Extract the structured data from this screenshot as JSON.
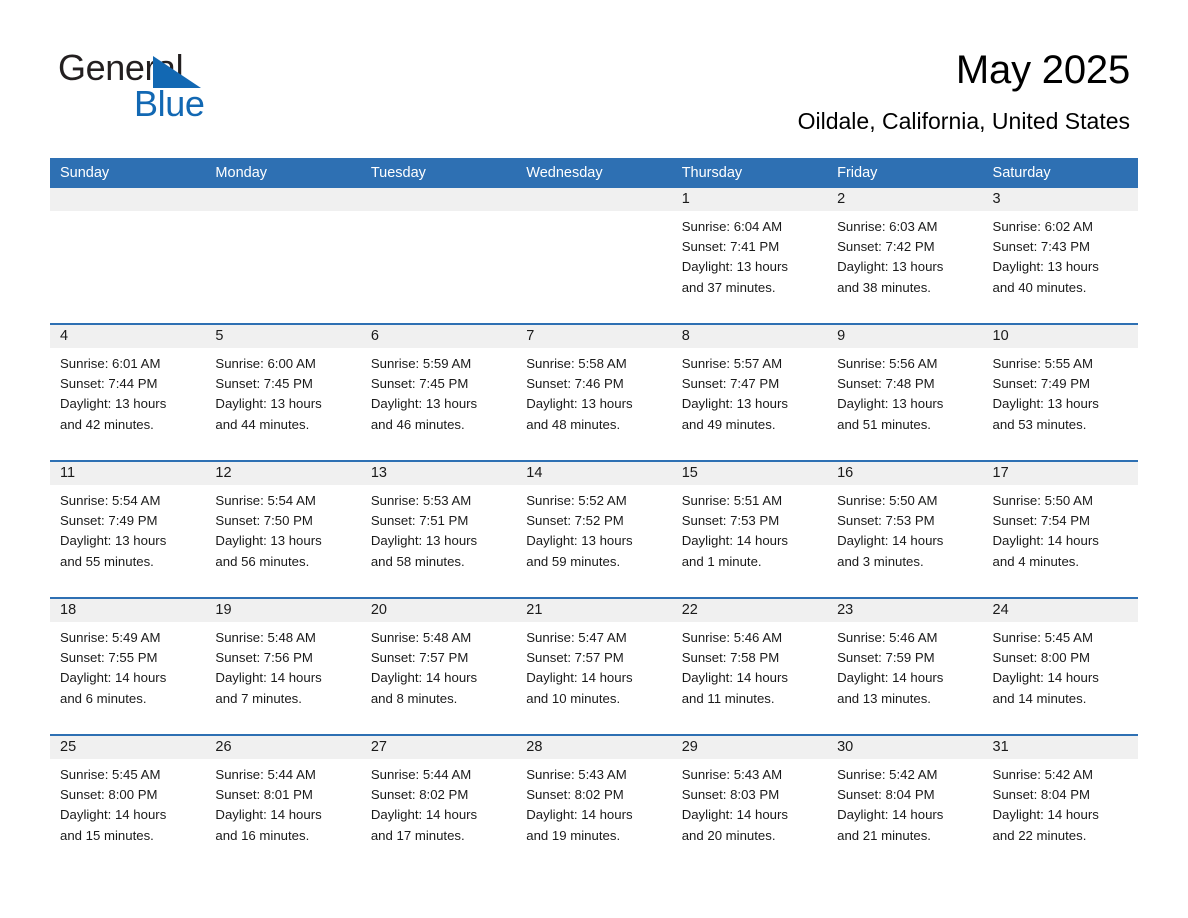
{
  "brand": {
    "name_part1": "General",
    "name_part2": "Blue",
    "triangle_color": "#1268b3",
    "text_color": "#231f20"
  },
  "header": {
    "month_title": "May 2025",
    "location": "Oildale, California, United States"
  },
  "colors": {
    "header_blue": "#2e70b3",
    "date_strip_gray": "#f0f0f0",
    "text": "#1a1a1a"
  },
  "calendar": {
    "weekday_headers": [
      "Sunday",
      "Monday",
      "Tuesday",
      "Wednesday",
      "Thursday",
      "Friday",
      "Saturday"
    ],
    "weeks": [
      {
        "days": [
          {
            "number": "",
            "sunrise": "",
            "sunset": "",
            "daylight1": "",
            "daylight2": ""
          },
          {
            "number": "",
            "sunrise": "",
            "sunset": "",
            "daylight1": "",
            "daylight2": ""
          },
          {
            "number": "",
            "sunrise": "",
            "sunset": "",
            "daylight1": "",
            "daylight2": ""
          },
          {
            "number": "",
            "sunrise": "",
            "sunset": "",
            "daylight1": "",
            "daylight2": ""
          },
          {
            "number": "1",
            "sunrise": "Sunrise: 6:04 AM",
            "sunset": "Sunset: 7:41 PM",
            "daylight1": "Daylight: 13 hours",
            "daylight2": "and 37 minutes."
          },
          {
            "number": "2",
            "sunrise": "Sunrise: 6:03 AM",
            "sunset": "Sunset: 7:42 PM",
            "daylight1": "Daylight: 13 hours",
            "daylight2": "and 38 minutes."
          },
          {
            "number": "3",
            "sunrise": "Sunrise: 6:02 AM",
            "sunset": "Sunset: 7:43 PM",
            "daylight1": "Daylight: 13 hours",
            "daylight2": "and 40 minutes."
          }
        ]
      },
      {
        "days": [
          {
            "number": "4",
            "sunrise": "Sunrise: 6:01 AM",
            "sunset": "Sunset: 7:44 PM",
            "daylight1": "Daylight: 13 hours",
            "daylight2": "and 42 minutes."
          },
          {
            "number": "5",
            "sunrise": "Sunrise: 6:00 AM",
            "sunset": "Sunset: 7:45 PM",
            "daylight1": "Daylight: 13 hours",
            "daylight2": "and 44 minutes."
          },
          {
            "number": "6",
            "sunrise": "Sunrise: 5:59 AM",
            "sunset": "Sunset: 7:45 PM",
            "daylight1": "Daylight: 13 hours",
            "daylight2": "and 46 minutes."
          },
          {
            "number": "7",
            "sunrise": "Sunrise: 5:58 AM",
            "sunset": "Sunset: 7:46 PM",
            "daylight1": "Daylight: 13 hours",
            "daylight2": "and 48 minutes."
          },
          {
            "number": "8",
            "sunrise": "Sunrise: 5:57 AM",
            "sunset": "Sunset: 7:47 PM",
            "daylight1": "Daylight: 13 hours",
            "daylight2": "and 49 minutes."
          },
          {
            "number": "9",
            "sunrise": "Sunrise: 5:56 AM",
            "sunset": "Sunset: 7:48 PM",
            "daylight1": "Daylight: 13 hours",
            "daylight2": "and 51 minutes."
          },
          {
            "number": "10",
            "sunrise": "Sunrise: 5:55 AM",
            "sunset": "Sunset: 7:49 PM",
            "daylight1": "Daylight: 13 hours",
            "daylight2": "and 53 minutes."
          }
        ]
      },
      {
        "days": [
          {
            "number": "11",
            "sunrise": "Sunrise: 5:54 AM",
            "sunset": "Sunset: 7:49 PM",
            "daylight1": "Daylight: 13 hours",
            "daylight2": "and 55 minutes."
          },
          {
            "number": "12",
            "sunrise": "Sunrise: 5:54 AM",
            "sunset": "Sunset: 7:50 PM",
            "daylight1": "Daylight: 13 hours",
            "daylight2": "and 56 minutes."
          },
          {
            "number": "13",
            "sunrise": "Sunrise: 5:53 AM",
            "sunset": "Sunset: 7:51 PM",
            "daylight1": "Daylight: 13 hours",
            "daylight2": "and 58 minutes."
          },
          {
            "number": "14",
            "sunrise": "Sunrise: 5:52 AM",
            "sunset": "Sunset: 7:52 PM",
            "daylight1": "Daylight: 13 hours",
            "daylight2": "and 59 minutes."
          },
          {
            "number": "15",
            "sunrise": "Sunrise: 5:51 AM",
            "sunset": "Sunset: 7:53 PM",
            "daylight1": "Daylight: 14 hours",
            "daylight2": "and 1 minute."
          },
          {
            "number": "16",
            "sunrise": "Sunrise: 5:50 AM",
            "sunset": "Sunset: 7:53 PM",
            "daylight1": "Daylight: 14 hours",
            "daylight2": "and 3 minutes."
          },
          {
            "number": "17",
            "sunrise": "Sunrise: 5:50 AM",
            "sunset": "Sunset: 7:54 PM",
            "daylight1": "Daylight: 14 hours",
            "daylight2": "and 4 minutes."
          }
        ]
      },
      {
        "days": [
          {
            "number": "18",
            "sunrise": "Sunrise: 5:49 AM",
            "sunset": "Sunset: 7:55 PM",
            "daylight1": "Daylight: 14 hours",
            "daylight2": "and 6 minutes."
          },
          {
            "number": "19",
            "sunrise": "Sunrise: 5:48 AM",
            "sunset": "Sunset: 7:56 PM",
            "daylight1": "Daylight: 14 hours",
            "daylight2": "and 7 minutes."
          },
          {
            "number": "20",
            "sunrise": "Sunrise: 5:48 AM",
            "sunset": "Sunset: 7:57 PM",
            "daylight1": "Daylight: 14 hours",
            "daylight2": "and 8 minutes."
          },
          {
            "number": "21",
            "sunrise": "Sunrise: 5:47 AM",
            "sunset": "Sunset: 7:57 PM",
            "daylight1": "Daylight: 14 hours",
            "daylight2": "and 10 minutes."
          },
          {
            "number": "22",
            "sunrise": "Sunrise: 5:46 AM",
            "sunset": "Sunset: 7:58 PM",
            "daylight1": "Daylight: 14 hours",
            "daylight2": "and 11 minutes."
          },
          {
            "number": "23",
            "sunrise": "Sunrise: 5:46 AM",
            "sunset": "Sunset: 7:59 PM",
            "daylight1": "Daylight: 14 hours",
            "daylight2": "and 13 minutes."
          },
          {
            "number": "24",
            "sunrise": "Sunrise: 5:45 AM",
            "sunset": "Sunset: 8:00 PM",
            "daylight1": "Daylight: 14 hours",
            "daylight2": "and 14 minutes."
          }
        ]
      },
      {
        "days": [
          {
            "number": "25",
            "sunrise": "Sunrise: 5:45 AM",
            "sunset": "Sunset: 8:00 PM",
            "daylight1": "Daylight: 14 hours",
            "daylight2": "and 15 minutes."
          },
          {
            "number": "26",
            "sunrise": "Sunrise: 5:44 AM",
            "sunset": "Sunset: 8:01 PM",
            "daylight1": "Daylight: 14 hours",
            "daylight2": "and 16 minutes."
          },
          {
            "number": "27",
            "sunrise": "Sunrise: 5:44 AM",
            "sunset": "Sunset: 8:02 PM",
            "daylight1": "Daylight: 14 hours",
            "daylight2": "and 17 minutes."
          },
          {
            "number": "28",
            "sunrise": "Sunrise: 5:43 AM",
            "sunset": "Sunset: 8:02 PM",
            "daylight1": "Daylight: 14 hours",
            "daylight2": "and 19 minutes."
          },
          {
            "number": "29",
            "sunrise": "Sunrise: 5:43 AM",
            "sunset": "Sunset: 8:03 PM",
            "daylight1": "Daylight: 14 hours",
            "daylight2": "and 20 minutes."
          },
          {
            "number": "30",
            "sunrise": "Sunrise: 5:42 AM",
            "sunset": "Sunset: 8:04 PM",
            "daylight1": "Daylight: 14 hours",
            "daylight2": "and 21 minutes."
          },
          {
            "number": "31",
            "sunrise": "Sunrise: 5:42 AM",
            "sunset": "Sunset: 8:04 PM",
            "daylight1": "Daylight: 14 hours",
            "daylight2": "and 22 minutes."
          }
        ]
      }
    ]
  }
}
